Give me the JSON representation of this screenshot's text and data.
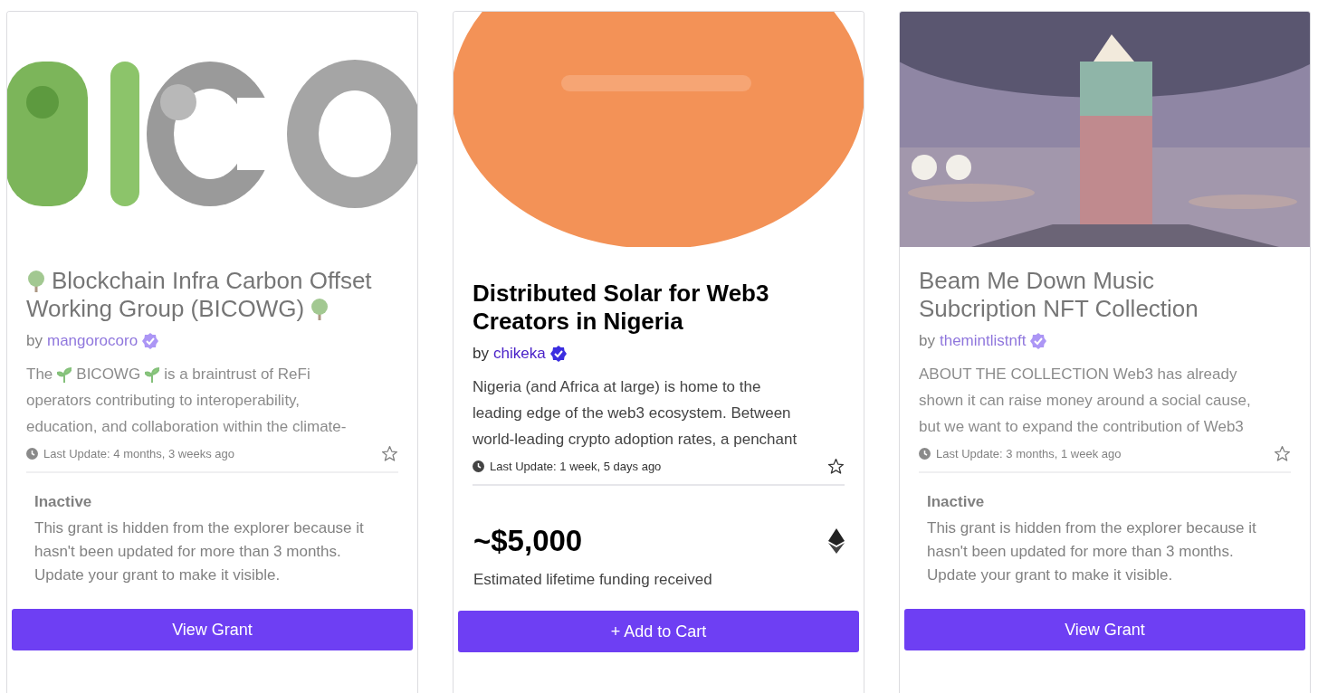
{
  "cards": [
    {
      "inactive": true,
      "title": [
        [
          {
            "kind": "icon"
          },
          "Blockchain Infra Carbon Offset"
        ],
        [
          "Working Group (BICOWG)",
          {
            "kind": "icon"
          }
        ]
      ],
      "author_prefix": "by",
      "author": "mangorocoro",
      "verified": true,
      "description": [
        [
          "The",
          {
            "kind": "icon"
          },
          "BICOWG",
          {
            "kind": "icon"
          },
          "is a braintrust of ReFi"
        ],
        [
          "operators contributing to interoperability,"
        ],
        [
          "education, and collaboration within the climate-"
        ]
      ],
      "last_update": "Last Update: 4 months, 3 weeks ago",
      "starred": false,
      "footer": {
        "kind": "notice",
        "heading": "Inactive",
        "text": "This grant is hidden from the explorer because it hasn't been updated for more than 3 months. Update your grant to make it visible."
      },
      "button": "View Grant"
    },
    {
      "inactive": false,
      "title": [
        [
          "Distributed Solar for Web3"
        ],
        [
          "Creators in Nigeria"
        ]
      ],
      "author_prefix": "by",
      "author": "chikeka",
      "verified": true,
      "description": [
        [
          "Nigeria (and Africa at large) is home to the"
        ],
        [
          "leading edge of the web3 ecosystem. Between"
        ],
        [
          "world-leading crypto adoption rates, a penchant"
        ]
      ],
      "last_update": "Last Update: 1 week, 5 days ago",
      "starred": false,
      "footer": {
        "kind": "funding",
        "amount": "~$5,000",
        "text": "Estimated lifetime funding received"
      },
      "button": "+ Add to Cart"
    },
    {
      "inactive": true,
      "title": [
        [
          "Beam Me Down Music"
        ],
        [
          "Subcription NFT Collection"
        ]
      ],
      "author_prefix": "by",
      "author": "themintlistnft",
      "verified": true,
      "description": [
        [
          "ABOUT THE COLLECTION Web3 has already"
        ],
        [
          "shown it can raise money around a social cause,"
        ],
        [
          "but we want to expand the contribution of Web3"
        ]
      ],
      "last_update": "Last Update: 3 months, 1 week ago",
      "starred": false,
      "footer": {
        "kind": "notice",
        "heading": "Inactive",
        "text": "This grant is hidden from the explorer because it hasn't been updated for more than 3 months. Update your grant to make it visible."
      },
      "button": "View Grant"
    }
  ]
}
